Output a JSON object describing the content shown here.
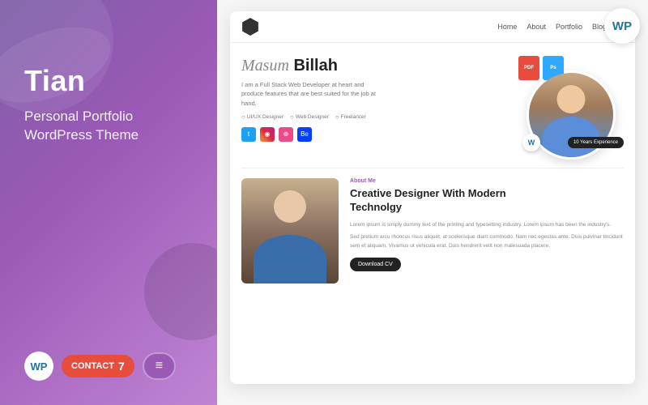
{
  "sidebar": {
    "title": "Tian",
    "subtitle_line1": "Personal Portfolio",
    "subtitle_line2": "WordPress Theme"
  },
  "badges": {
    "wp": "WP",
    "contact_form": "CONTACT",
    "cf_number": "7",
    "elementor": "≡"
  },
  "wp_badge": "WP",
  "preview": {
    "nav": {
      "logo": "",
      "links": [
        "Home",
        "About",
        "Portfolio",
        "Blog",
        ""
      ]
    },
    "hero": {
      "name_first": "Masum",
      "name_last": "Billah",
      "description": "I am a Full Stack Web Developer at heart and produce features that are best suited for the job at hand.",
      "tags": [
        "UI/UX Designer",
        "Web Designer",
        "Freelancer"
      ],
      "social": [
        "T",
        "I",
        "D",
        "Be"
      ],
      "profile_badge_w": "W",
      "experience": "10 Years Experience"
    },
    "file_icons": {
      "pdf": "PDF",
      "psd": "Ps"
    },
    "about": {
      "label": "About Me",
      "title_line1": "Creative Designer With Modern",
      "title_line2": "Technolgy",
      "para1": "Lorem ipsum is simply dummy text of the printing and typesetting industry. Lorem ipsum has been the industry's.",
      "para2": "Sed pretium arcu rhoncus risus aliquet, at scelerisque diam commodo. Nam nec egestas ante. Duis pulvinar tincidunt sem et aliquam. Vivamus ut vehicula erat. Duis hendrerit velit non malesuada placere.",
      "download_btn": "Download CV"
    }
  }
}
